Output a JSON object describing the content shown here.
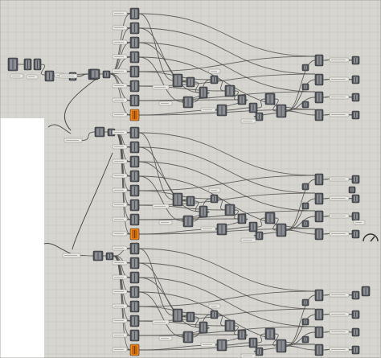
{
  "canvas": {
    "background": "#d6d5cf",
    "grid_color": "#c4c3bc",
    "blank_color": "#ffffff",
    "wire_color": "#4d4d4d",
    "component_color": "#53565b",
    "component_highlight": "#8a8d92",
    "param_color": "#e9e8e4",
    "accent_component_color": "#f08a1d"
  },
  "groups": [
    {
      "id": "group-1",
      "output_slots": 4,
      "has_orange_component": true
    },
    {
      "id": "group-2",
      "output_slots": 4,
      "has_orange_component": true
    },
    {
      "id": "group-3",
      "output_slots": 4,
      "has_orange_component": true
    }
  ],
  "indicators": [
    {
      "name": "dial-icon"
    }
  ]
}
